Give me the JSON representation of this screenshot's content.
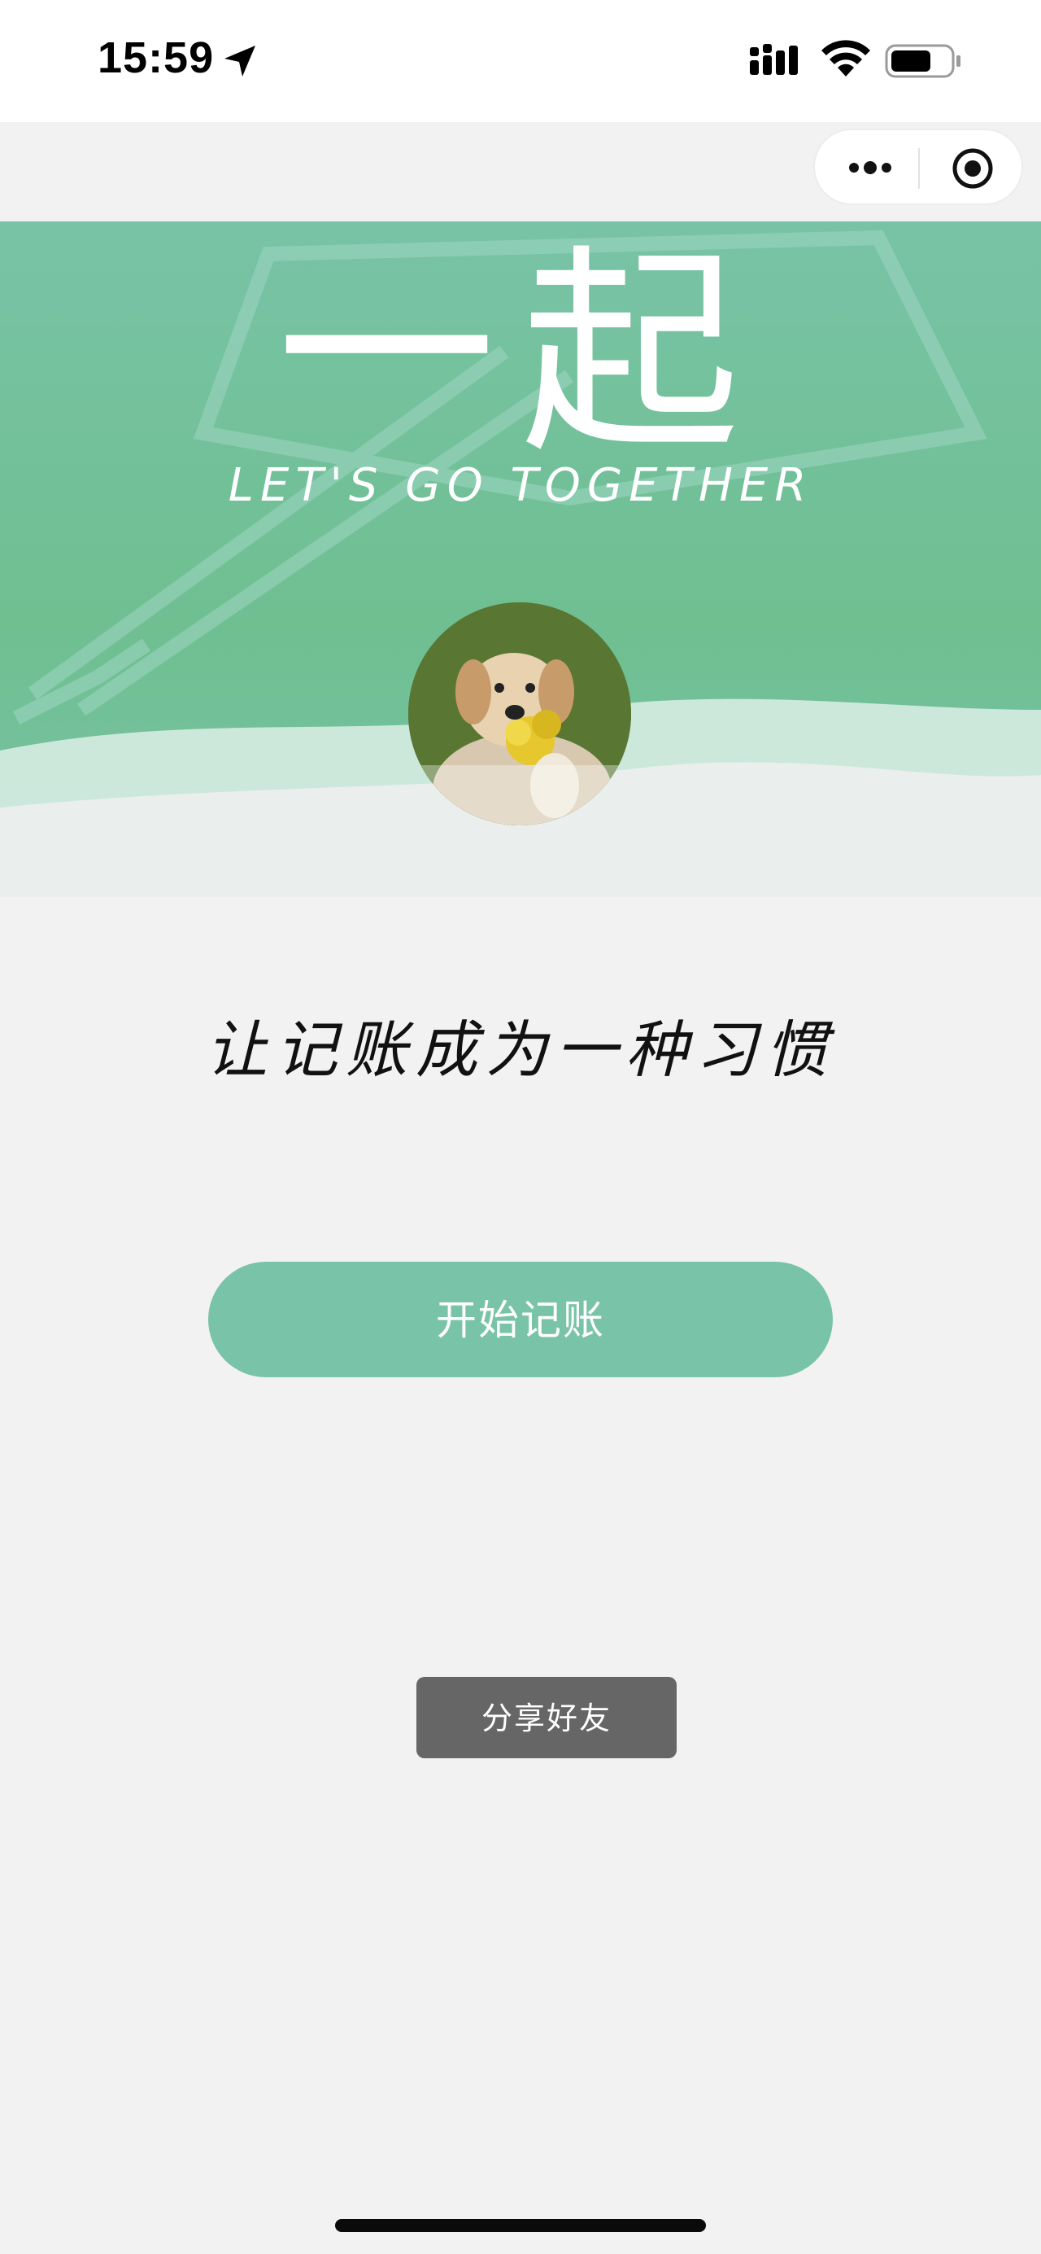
{
  "status_bar": {
    "time": "15:59",
    "icons": [
      "location-arrow-icon",
      "cellular-signal-icon",
      "wifi-icon",
      "battery-icon"
    ]
  },
  "capsule": {
    "icons": [
      "more-dots-icon",
      "close-target-icon"
    ]
  },
  "banner": {
    "title": "一起",
    "subtitle": "LET'S GO TOGETHER",
    "colors": {
      "primary": "#78c3a6",
      "secondary": "#6fbf91"
    }
  },
  "main": {
    "slogan": "让记账成为一种习惯",
    "start_button": "开始记账",
    "share_button": "分享好友"
  },
  "colors": {
    "accent": "#79c3a8",
    "share_bg": "#666666",
    "page_bg": "#f2f2f2"
  }
}
